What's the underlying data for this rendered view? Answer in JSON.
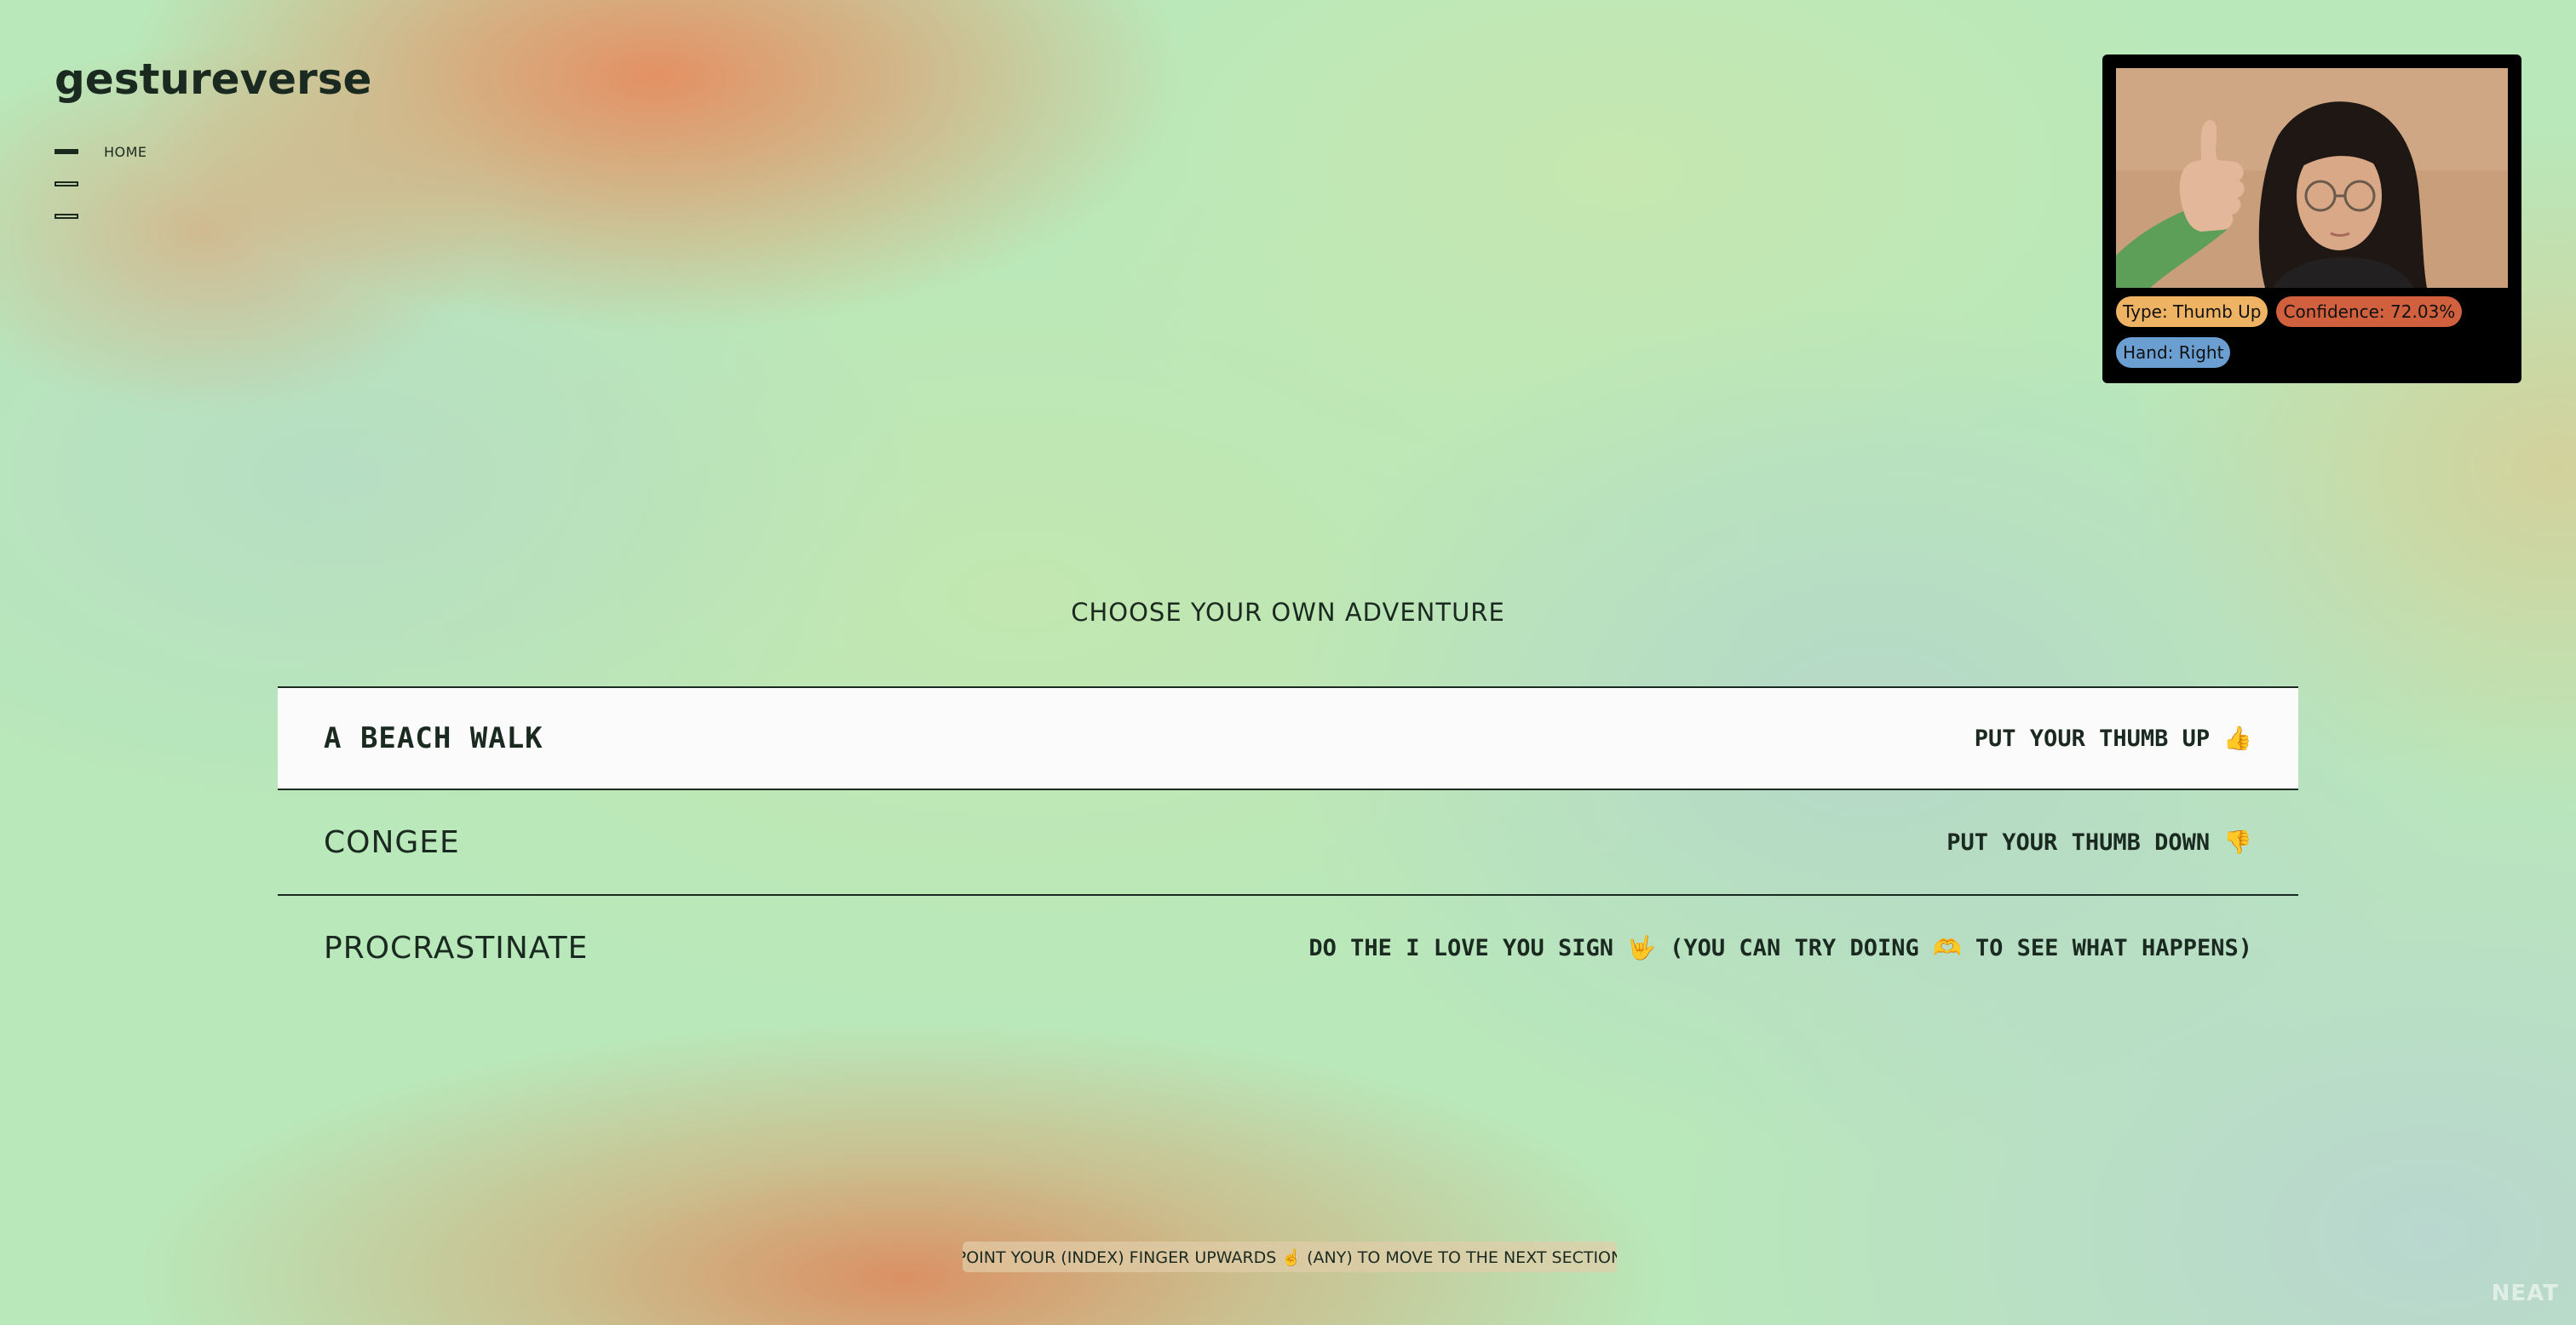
{
  "app": {
    "brand": "gestureverse"
  },
  "nav": {
    "items": [
      {
        "label": "HOME",
        "active": true
      },
      {
        "label": "",
        "active": false
      },
      {
        "label": "",
        "active": false
      }
    ]
  },
  "camera": {
    "badges": {
      "type": "Type: Thumb Up",
      "confidence": "Confidence: 72.03%",
      "hand": "Hand: Right"
    }
  },
  "main": {
    "heading": "CHOOSE YOUR OWN ADVENTURE",
    "options": [
      {
        "title": "A BEACH WALK",
        "hint": "PUT YOUR THUMB UP 👍",
        "selected": true
      },
      {
        "title": "CONGEE",
        "hint": "PUT YOUR THUMB DOWN 👎",
        "selected": false
      },
      {
        "title": "PROCRASTINATE",
        "hint": "DO THE I LOVE YOU SIGN 🤟 (YOU CAN TRY DOING 🫶 TO SEE WHAT HAPPENS)",
        "selected": false
      }
    ]
  },
  "footer": {
    "hint": "POINT YOUR (INDEX) FINGER UPWARDS ☝️ (ANY) TO MOVE TO THE NEXT SECTION"
  },
  "watermark": "NEAT",
  "colors": {
    "badge_type": "#eeb463",
    "badge_confidence": "#d0603e",
    "badge_hand": "#6b9fd2",
    "selected_row": "#fbfbfb",
    "ink": "#1b2a20"
  }
}
